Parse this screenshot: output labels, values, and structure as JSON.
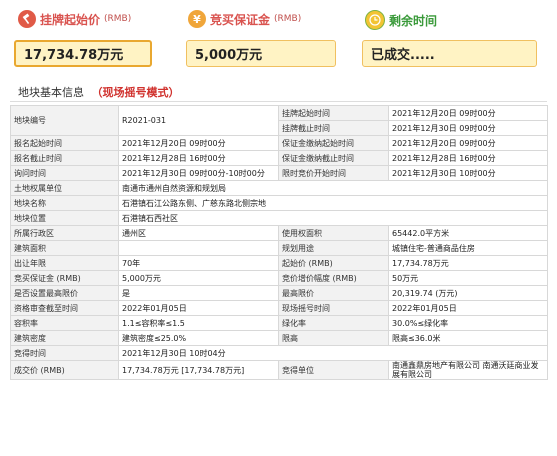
{
  "header": {
    "start_price": {
      "label": "挂牌起始价",
      "unit": "(RMB)",
      "value": "17,734.78万元"
    },
    "deposit": {
      "label": "竞买保证金",
      "unit": "(RMB)",
      "value": "5,000万元"
    },
    "time_left": {
      "label": "剩余时间",
      "value": "已成交....."
    }
  },
  "section": {
    "title": "地块基本信息",
    "mode": "（现场摇号模式）"
  },
  "rows": [
    {
      "k1": "地块编号",
      "v1": "R2021-031",
      "k2": "挂牌起始时间",
      "v2": "2021年12月20日 09时00分"
    },
    {
      "k1": "",
      "v1": "",
      "k2": "挂牌截止时间",
      "v2": "2021年12月30日 09时00分"
    },
    {
      "k1": "报名起始时间",
      "v1": "2021年12月20日 09时00分",
      "k2": "保证金缴纳起始时间",
      "v2": "2021年12月20日 09时00分"
    },
    {
      "k1": "报名截止时间",
      "v1": "2021年12月28日 16时00分",
      "k2": "保证金缴纳截止时间",
      "v2": "2021年12月28日 16时00分"
    },
    {
      "k1": "询问时间",
      "v1": "2021年12月30日 09时00分-10时00分",
      "k2": "限时竞价开始时间",
      "v2": "2021年12月30日 10时00分"
    },
    {
      "k1": "土地权属单位",
      "v1": "南通市通州自然资源和规划局"
    },
    {
      "k1": "地块名称",
      "v1": "石港镇石江公路东侧、广慈东路北侧宗地"
    },
    {
      "k1": "地块位置",
      "v1": "石港镇石西社区"
    },
    {
      "k1": "所属行政区",
      "v1": "通州区",
      "k2": "使用权面积",
      "v2": "65442.0平方米"
    },
    {
      "k1": "建筑面积",
      "v1": "",
      "k2": "规划用途",
      "v2": "城镇住宅-普通商品住房"
    },
    {
      "k1": "出让年限",
      "v1": "70年",
      "k2": "起始价 (RMB)",
      "v2": "17,734.78万元"
    },
    {
      "k1": "竞买保证金 (RMB)",
      "v1": "5,000万元",
      "k2": "竞价增价幅度 (RMB)",
      "v2": "50万元"
    },
    {
      "k1": "是否设置最高限价",
      "v1": "是",
      "k2": "最高限价",
      "v2": "20,319.74 (万元)"
    },
    {
      "k1": "资格审查截至时间",
      "v1": "2022年01月05日",
      "k2": "现场摇号时间",
      "v2": "2022年01月05日"
    },
    {
      "k1": "容积率",
      "v1": "1.1≤容积率≤1.5",
      "k2": "绿化率",
      "v2": "30.0%≤绿化率"
    },
    {
      "k1": "建筑密度",
      "v1": "建筑密度≤25.0%",
      "k2": "限高",
      "v2": "限高≤36.0米"
    },
    {
      "k1": "竞得时间",
      "v1": "2021年12月30日 10时04分"
    },
    {
      "k1": "成交价 (RMB)",
      "v1": "17,734.78万元 [17,734.78万元]",
      "k2": "竞得单位",
      "v2": "南通鑫鼎房地产有限公司 南通沃廷商业发展有限公司"
    }
  ],
  "colors": {
    "accent_red": "#d9534f",
    "box_fill": "#fff3c4",
    "box_border": "#f0c060"
  }
}
